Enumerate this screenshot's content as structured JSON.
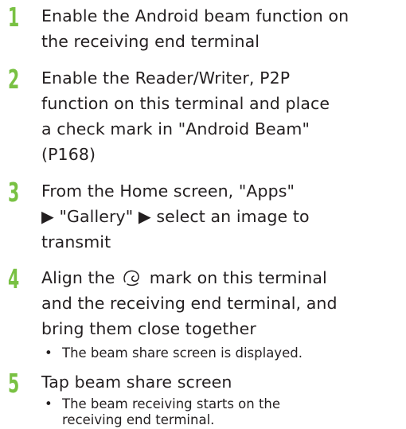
{
  "accent_color": "#79c143",
  "steps": [
    {
      "number": "1",
      "lines": [
        "Enable the Android beam function on",
        "the receiving end terminal"
      ]
    },
    {
      "number": "2",
      "lines": [
        "Enable the Reader/Writer, P2P",
        "function on this terminal and place",
        "a check mark in \"Android Beam\"",
        "(P168)"
      ]
    },
    {
      "number": "3",
      "lines": [
        "From the Home screen, \"Apps\"",
        "▶ \"Gallery\" ▶ select an image to",
        "transmit"
      ]
    },
    {
      "number": "4",
      "line1_before_icon": "Align the",
      "line1_after_icon": "mark on this terminal",
      "icon": "nfc-mark-icon",
      "lines": [
        "and the receiving end terminal, and",
        "bring them close together"
      ],
      "note": {
        "bullet": "•",
        "text": "The beam share screen is displayed."
      }
    },
    {
      "number": "5",
      "lines": [
        "Tap beam share screen"
      ],
      "note": {
        "bullet": "•",
        "lines": [
          "The beam receiving starts on the",
          "receiving end terminal."
        ]
      }
    }
  ]
}
